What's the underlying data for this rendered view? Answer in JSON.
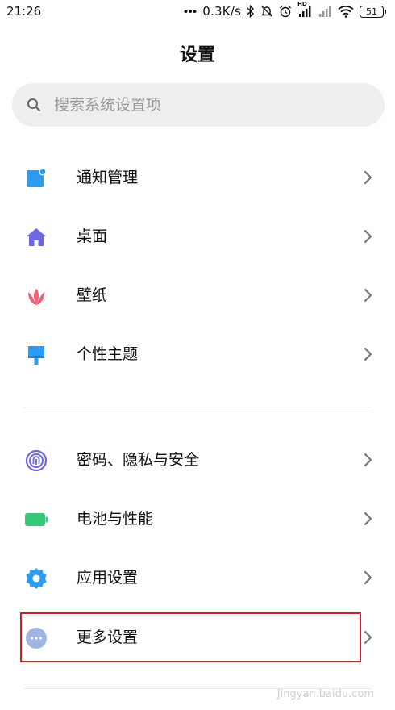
{
  "status_bar": {
    "time": "21:26",
    "network_speed": "0.3K/s",
    "signal_label": "HD",
    "battery_level": "51"
  },
  "header": {
    "title": "设置"
  },
  "search": {
    "placeholder": "搜索系统设置项"
  },
  "sections": [
    {
      "items": [
        {
          "label": "通知管理",
          "icon": "notification-icon",
          "color": "#2d9cf0"
        },
        {
          "label": "桌面",
          "icon": "home-icon",
          "color": "#6d67e4"
        },
        {
          "label": "壁纸",
          "icon": "tulip-icon",
          "color": "#f0607a"
        },
        {
          "label": "个性主题",
          "icon": "brush-icon",
          "color": "#2d9cf0"
        }
      ]
    },
    {
      "items": [
        {
          "label": "密码、隐私与安全",
          "icon": "fingerprint-icon",
          "color": "#6d67e4"
        },
        {
          "label": "电池与性能",
          "icon": "battery-icon",
          "color": "#36c87a"
        },
        {
          "label": "应用设置",
          "icon": "gear-icon",
          "color": "#2d9cf0"
        },
        {
          "label": "更多设置",
          "icon": "more-icon",
          "color": "#9fb6e4",
          "highlighted": true
        }
      ]
    }
  ],
  "colors": {
    "highlight_border": "#d31f25",
    "chevron": "#777777"
  },
  "watermark": {
    "text": "Jingyan.baidu.com"
  }
}
